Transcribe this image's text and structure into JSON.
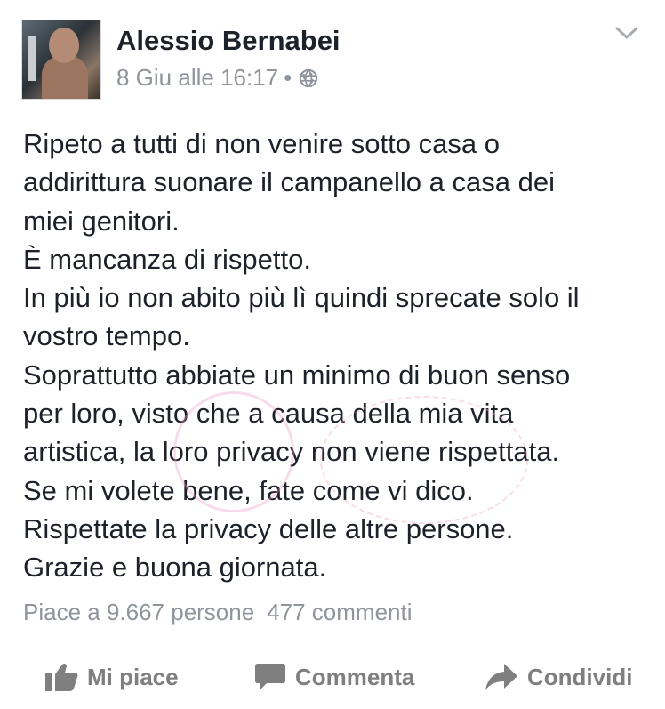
{
  "post": {
    "author": "Alessio Bernabei",
    "timestamp": "8 Giu alle 16:17",
    "separator": "•",
    "privacy_icon": "globe-icon",
    "menu_icon": "chevron-down-icon",
    "body": "Ripeto a tutti di non venire sotto casa o\naddirittura suonare il campanello a casa dei\nmiei genitori.\nÈ mancanza di rispetto.\nIn più io non abito più lì quindi sprecate solo il\nvostro tempo.\nSoprattutto abbiate un minimo di buon senso\nper loro, visto che a causa della mia vita\nartistica, la loro privacy non viene rispettata.\nSe mi volete bene, fate come vi dico.\nRispettate la privacy delle altre persone.\nGrazie e buona giornata.",
    "likes": "Piace a 9.667 persone",
    "comments": "477 commenti"
  },
  "actions": {
    "like": {
      "label": "Mi piace",
      "icon": "thumbs-up-icon"
    },
    "comment": {
      "label": "Commenta",
      "icon": "comment-bubble-icon"
    },
    "share": {
      "label": "Condividi",
      "icon": "share-arrow-icon"
    }
  },
  "colors": {
    "text": "#1d2129",
    "muted": "#90949c",
    "action": "#7f7f7f",
    "divider": "#e5e6e9"
  }
}
